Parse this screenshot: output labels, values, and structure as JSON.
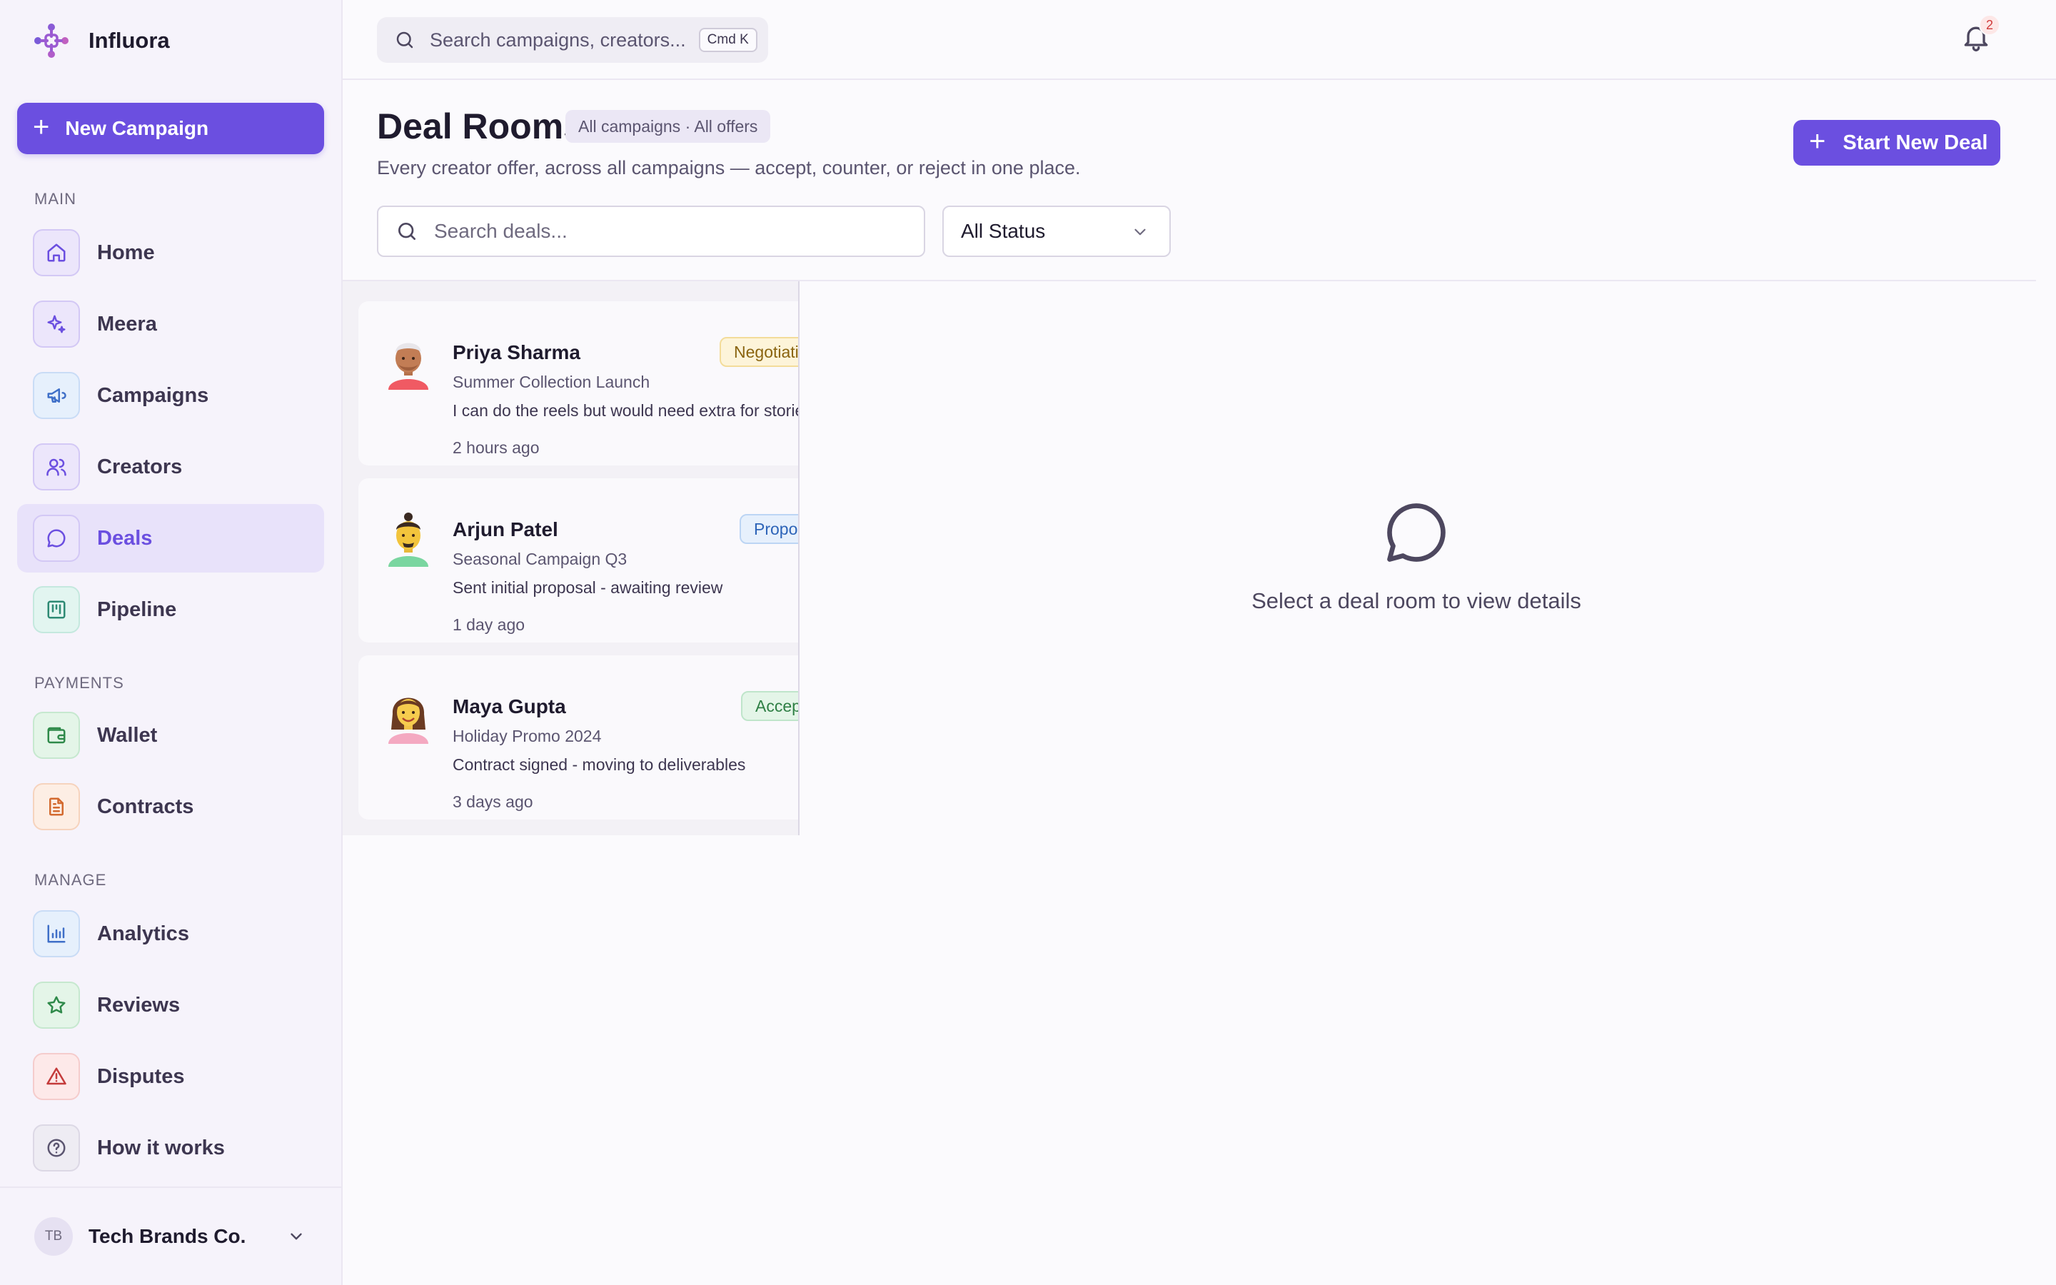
{
  "brand": {
    "name": "Influora",
    "logo_icon": "influora-logo-icon"
  },
  "sidebar": {
    "new_campaign_label": "New Campaign",
    "sections": {
      "main": "MAIN",
      "payments": "PAYMENTS",
      "manage": "MANAGE"
    },
    "items": [
      {
        "label": "Home",
        "icon": "home-icon",
        "active": false
      },
      {
        "label": "Meera",
        "icon": "sparkles-icon",
        "active": false
      },
      {
        "label": "Campaigns",
        "icon": "megaphone-icon",
        "active": false
      },
      {
        "label": "Creators",
        "icon": "users-icon",
        "active": false
      },
      {
        "label": "Deals",
        "icon": "chat-bubble-icon",
        "active": true
      },
      {
        "label": "Pipeline",
        "icon": "kanban-icon",
        "active": false
      },
      {
        "label": "Wallet",
        "icon": "wallet-icon",
        "active": false
      },
      {
        "label": "Contracts",
        "icon": "document-icon",
        "active": false
      },
      {
        "label": "Analytics",
        "icon": "bar-chart-icon",
        "active": false
      },
      {
        "label": "Reviews",
        "icon": "star-icon",
        "active": false
      },
      {
        "label": "Disputes",
        "icon": "warning-icon",
        "active": false
      },
      {
        "label": "How it works",
        "icon": "help-circle-icon",
        "active": false
      }
    ],
    "footer": {
      "initials": "TB",
      "org_name": "Tech Brands Co."
    }
  },
  "topbar": {
    "search_placeholder": "Search campaigns, creators...",
    "shortcut": "Cmd K",
    "notification_count": "2"
  },
  "page": {
    "title": "Deal Rooms",
    "scope_chip": "All campaigns · All offers",
    "subtitle": "Every creator offer, across all campaigns — accept, counter, or reject in one place.",
    "start_deal_label": "Start New Deal",
    "deal_search_placeholder": "Search deals...",
    "status_filter": "All Status"
  },
  "deals": [
    {
      "name": "Priya Sharma",
      "campaign": "Summer Collection Launch",
      "message": "I can do the reels but would need extra for stories",
      "time": "2 hours ago",
      "status": "Negotiating"
    },
    {
      "name": "Arjun Patel",
      "campaign": "Seasonal Campaign Q3",
      "message": "Sent initial proposal - awaiting review",
      "time": "1 day ago",
      "status": "Proposed"
    },
    {
      "name": "Maya Gupta",
      "campaign": "Holiday Promo 2024",
      "message": "Contract signed - moving to deliverables",
      "time": "3 days ago",
      "status": "Accepted"
    }
  ],
  "empty_state": {
    "text": "Select a deal room to view details",
    "icon": "chat-bubble-icon"
  },
  "colors": {
    "accent": "#6b4fe0",
    "active_nav_bg": "#e8e2fa"
  }
}
